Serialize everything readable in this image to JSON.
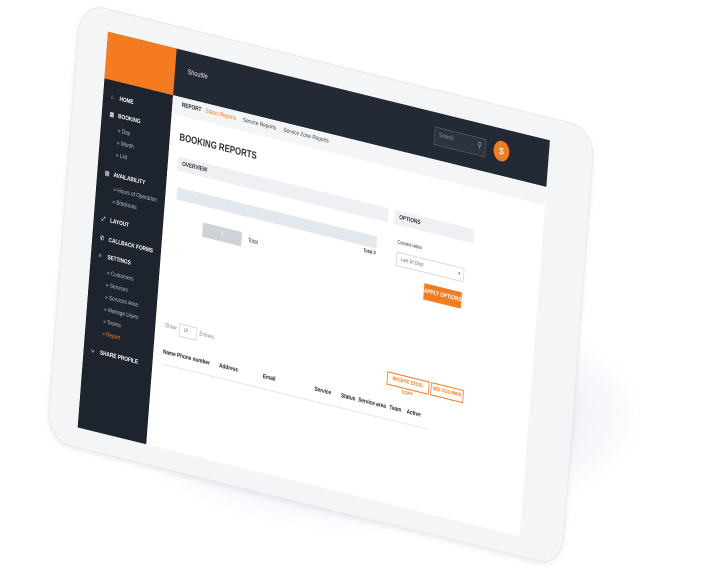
{
  "colors": {
    "accent": "#f47b20",
    "topbar": "#232a35",
    "sidebar": "#1e242e"
  },
  "topbar": {
    "brand": "Shouttle",
    "search_placeholder": "Search",
    "search_icon": "search-icon",
    "avatar_initial": "S"
  },
  "sidebar": {
    "home": "HOME",
    "booking": "BOOKING",
    "booking_sub": [
      "» Day",
      "» Month",
      "» List"
    ],
    "availability": "AVAILABILITY",
    "availability_sub": [
      "» Hours of Operation",
      "» Blackouts"
    ],
    "layout": "LAYOUT",
    "callback_forms": "CALLBACK FORMS",
    "settings": "SETTINGS",
    "settings_sub": [
      "» Customers",
      "» Services",
      "» Services Area",
      "» Manage Users",
      "» Teams",
      "» Report"
    ],
    "share_profile": "SHARE PROFILE"
  },
  "breadcrumb": {
    "report": "REPORT",
    "status": "Status Reports",
    "service": "Service Reports",
    "service_zone": "Service Zone Reports"
  },
  "page": {
    "title": "BOOKING REPORTS"
  },
  "overview": {
    "title": "OVERVIEW",
    "total_label": "Total 0",
    "count": "0",
    "total_text": "Total"
  },
  "options": {
    "title": "OPTIONS",
    "created_within": "Created within",
    "range_value": "Last 30 Days",
    "apply": "APPLY OPTIONS"
  },
  "table": {
    "show": "Show",
    "entries_value": "10",
    "entries": "Entries",
    "export": "RECEIVE EXCEL COPY",
    "columns": "SEE COLUMNS",
    "headers": [
      "Name",
      "Phone number",
      "Address",
      "Email",
      "Service",
      "Status",
      "Service area",
      "Team",
      "Active"
    ]
  }
}
